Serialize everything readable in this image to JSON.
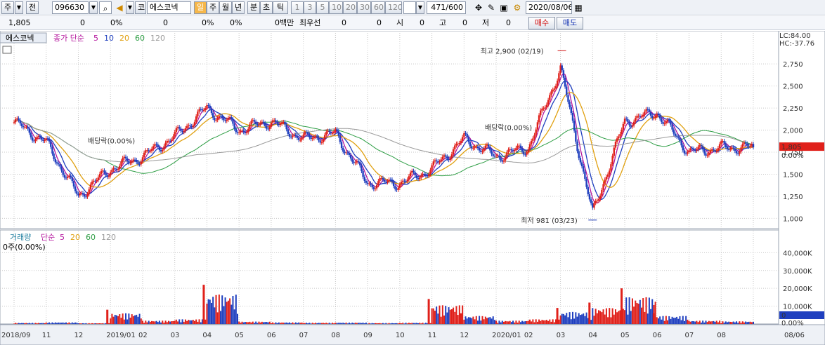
{
  "toolbar": {
    "period_selector": "주",
    "prev_label": "전",
    "stock_code": "096630",
    "stock_name": "에스코넥",
    "market_tag": "코",
    "period_buttons": [
      "일",
      "주",
      "월",
      "년",
      "분",
      "초",
      "틱"
    ],
    "interval_buttons": [
      "1",
      "3",
      "5",
      "10",
      "20",
      "30",
      "60",
      "120"
    ],
    "count_value": "471",
    "count_total": "/600",
    "date": "2020/08/06"
  },
  "quote": {
    "price": "1,805",
    "change": "0",
    "change_pct": "0%",
    "volume": "0",
    "vol_pct": "0%",
    "vol_pct2": "0%",
    "amount": "0백만",
    "best_label": "최우선",
    "best_a": "0",
    "best_b": "0",
    "open_label": "시",
    "open_val": "0",
    "high_label": "고",
    "high_val": "0",
    "low_label": "저",
    "low_val": "0",
    "buy_label": "매수",
    "sell_label": "매도"
  },
  "price_pane": {
    "legend_name": "에스코넥",
    "legend_ma": "종가 단순",
    "ma_periods": [
      "5",
      "10",
      "20",
      "60",
      "120"
    ],
    "ma_colors": [
      "#b5179e",
      "#1f3fbf",
      "#e0a010",
      "#2e9e45",
      "#9a9a9a"
    ],
    "lc_label": "LC:84.00",
    "hc_label": "HC:-37.76",
    "current_price_label": "1,805",
    "current_change_label": "0.00%",
    "high_annotation": "최고 2,900 (02/19)",
    "low_annotation": "최저 981 (03/23)",
    "dividend_annotation_1": "배당락(0.00%)",
    "dividend_annotation_2": "배당락(0.00%)",
    "y_ticks": [
      "2,750",
      "2,500",
      "2,250",
      "2,000",
      "1,750",
      "1,500",
      "1,250",
      "1,000"
    ]
  },
  "volume_pane": {
    "legend_name": "거래량",
    "legend_ma": "단순",
    "ma_periods": [
      "5",
      "20",
      "60",
      "120"
    ],
    "ma_colors": [
      "#b5179e",
      "#e0a010",
      "#2e9e45",
      "#9a9a9a"
    ],
    "current_label": "0주(0.00%)",
    "current_value_label": "0",
    "current_pct_label": "0.00%",
    "y_ticks": [
      "40,000K",
      "30,000K",
      "20,000K",
      "10,000K"
    ]
  },
  "x_labels": [
    "2018/09",
    "11",
    "12",
    "2019/01",
    "02",
    "03",
    "04",
    "05",
    "06",
    "07",
    "08",
    "09",
    "10",
    "11",
    "12",
    "2020/01",
    "02",
    "03",
    "04",
    "05",
    "06",
    "07",
    "08",
    "08/06"
  ],
  "colors": {
    "up": "#e0201a",
    "down": "#1f3fbf",
    "highlight_bar": "#e0201a",
    "grid": "#c8c8c8"
  },
  "chart_data": {
    "type": "candlestick",
    "ticker": "에스코넥",
    "code": "096630",
    "ylim": [
      900,
      2950
    ],
    "volume_ylim": [
      0,
      48000
    ],
    "volume_unit": "K",
    "x": [
      "2018/09",
      "2018/10",
      "2018/11",
      "2018/12",
      "2019/01",
      "2019/02",
      "2019/03",
      "2019/04",
      "2019/05",
      "2019/06",
      "2019/07",
      "2019/08",
      "2019/09",
      "2019/10",
      "2019/11",
      "2019/12",
      "2020/01",
      "2020/02",
      "2020/03",
      "2020/04",
      "2020/05",
      "2020/06",
      "2020/07",
      "2020/08"
    ],
    "close": [
      2090,
      1860,
      1250,
      1560,
      1700,
      1930,
      2250,
      2000,
      2100,
      1900,
      1960,
      1400,
      1400,
      1560,
      1900,
      1700,
      1800,
      2700,
      1050,
      2100,
      2200,
      1750,
      1800,
      1805
    ],
    "volume": [
      800,
      1200,
      600,
      8000,
      2500,
      3500,
      22000,
      1800,
      1200,
      900,
      1000,
      700,
      900,
      14000,
      6000,
      2500,
      3500,
      9000,
      12000,
      20000,
      6000,
      2500,
      2000,
      3000
    ],
    "annotations": [
      {
        "text": "최고 2,900 (02/19)",
        "x": "2020/02",
        "y": 2900
      },
      {
        "text": "최저 981 (03/23)",
        "x": "2020/03",
        "y": 981
      }
    ]
  }
}
